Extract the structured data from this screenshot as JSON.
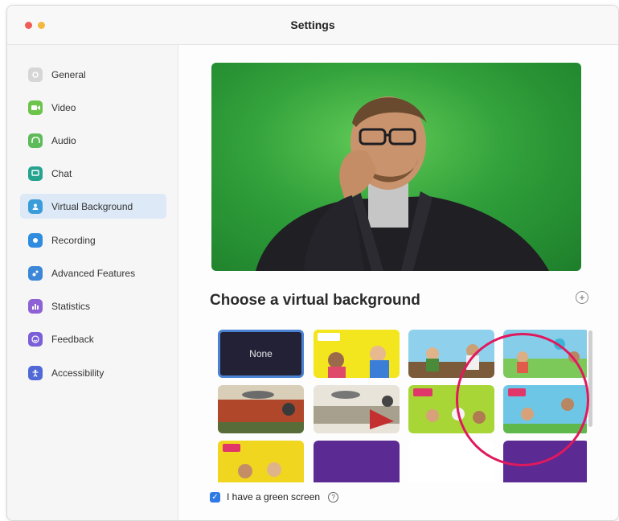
{
  "window": {
    "title": "Settings"
  },
  "sidebar": {
    "items": [
      {
        "label": "General",
        "icon": "gear-icon",
        "color": "#d6d6d6",
        "active": false
      },
      {
        "label": "Video",
        "icon": "video-icon",
        "color": "#6cc44b",
        "active": false
      },
      {
        "label": "Audio",
        "icon": "headphones-icon",
        "color": "#5dbb59",
        "active": false
      },
      {
        "label": "Chat",
        "icon": "chat-icon",
        "color": "#25a38f",
        "active": false
      },
      {
        "label": "Virtual Background",
        "icon": "person-icon",
        "color": "#3a9cd9",
        "active": true
      },
      {
        "label": "Recording",
        "icon": "record-icon",
        "color": "#2f8cde",
        "active": false
      },
      {
        "label": "Advanced Features",
        "icon": "advanced-icon",
        "color": "#3d87d9",
        "active": false
      },
      {
        "label": "Statistics",
        "icon": "chart-icon",
        "color": "#8e62d4",
        "active": false
      },
      {
        "label": "Feedback",
        "icon": "smile-icon",
        "color": "#7a5fd8",
        "active": false
      },
      {
        "label": "Accessibility",
        "icon": "accessibility-icon",
        "color": "#5169d6",
        "active": false
      }
    ]
  },
  "main": {
    "section_title": "Choose a virtual background",
    "thumbnails": [
      {
        "label": "None",
        "selected": true
      },
      {
        "label": "",
        "selected": false
      },
      {
        "label": "",
        "selected": false
      },
      {
        "label": "",
        "selected": false
      },
      {
        "label": "",
        "selected": false
      },
      {
        "label": "",
        "selected": false
      },
      {
        "label": "",
        "selected": false
      },
      {
        "label": "",
        "selected": false
      },
      {
        "label": "",
        "selected": false
      },
      {
        "label": "",
        "selected": false
      },
      {
        "label": "",
        "selected": false
      },
      {
        "label": "",
        "selected": false
      }
    ],
    "green_screen": {
      "label": "I have a green screen",
      "checked": true
    }
  },
  "colors": {
    "accent": "#2f7ae5",
    "annotation": "#e0195e",
    "selected_border": "#4a82d4"
  }
}
